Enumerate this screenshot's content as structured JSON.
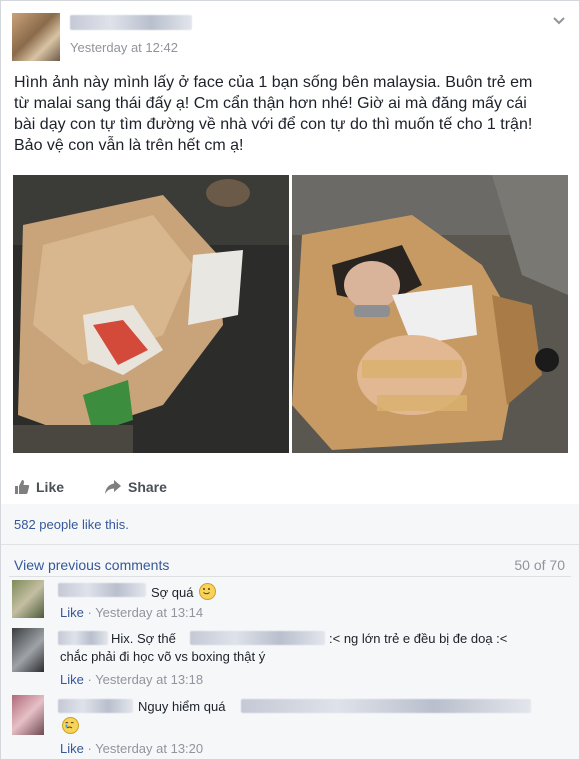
{
  "post": {
    "timestamp": "Yesterday at 12:42",
    "menu_icon": "chevron-down-icon",
    "text_lines": [
      "Hình ảnh này mình lấy ở face của 1 bạn sống bên malaysia. Buôn trẻ em",
      "từ malai sang thái đấy ạ! Cm cẩn thận hơn nhé! Giờ ai mà đăng mấy cái",
      "bài dạy con tự tìm đường về nhà với để con tự do thì muốn tế cho 1 trận!",
      "Bảo vệ con vẫn là trên hết cm ạ!"
    ]
  },
  "actions": {
    "like_label": "Like",
    "share_label": "Share"
  },
  "likes_text": "582 people like this.",
  "comments": {
    "view_previous": "View previous comments",
    "count": "50 of 70",
    "items": [
      {
        "text": "Sợ quá",
        "emoji": "slightly-smiling-emoji",
        "like": "Like",
        "time": "Yesterday at 13:14"
      },
      {
        "text_a": "Hix. Sợ thế",
        "text_b": ":< ng lớn trẻ e đều bị đe doạ :<",
        "text_c": "chắc phải đi học võ vs boxing thật ý",
        "like": "Like",
        "time": "Yesterday at 13:18"
      },
      {
        "text": "Nguy hiểm quá",
        "emoji": "crying-emoji",
        "like": "Like",
        "time": "Yesterday at 13:20"
      }
    ],
    "separator": " · "
  },
  "colors": {
    "link": "#365899",
    "meta": "#90949c",
    "text": "#1d2129",
    "comment_bg": "#f6f7f9"
  }
}
